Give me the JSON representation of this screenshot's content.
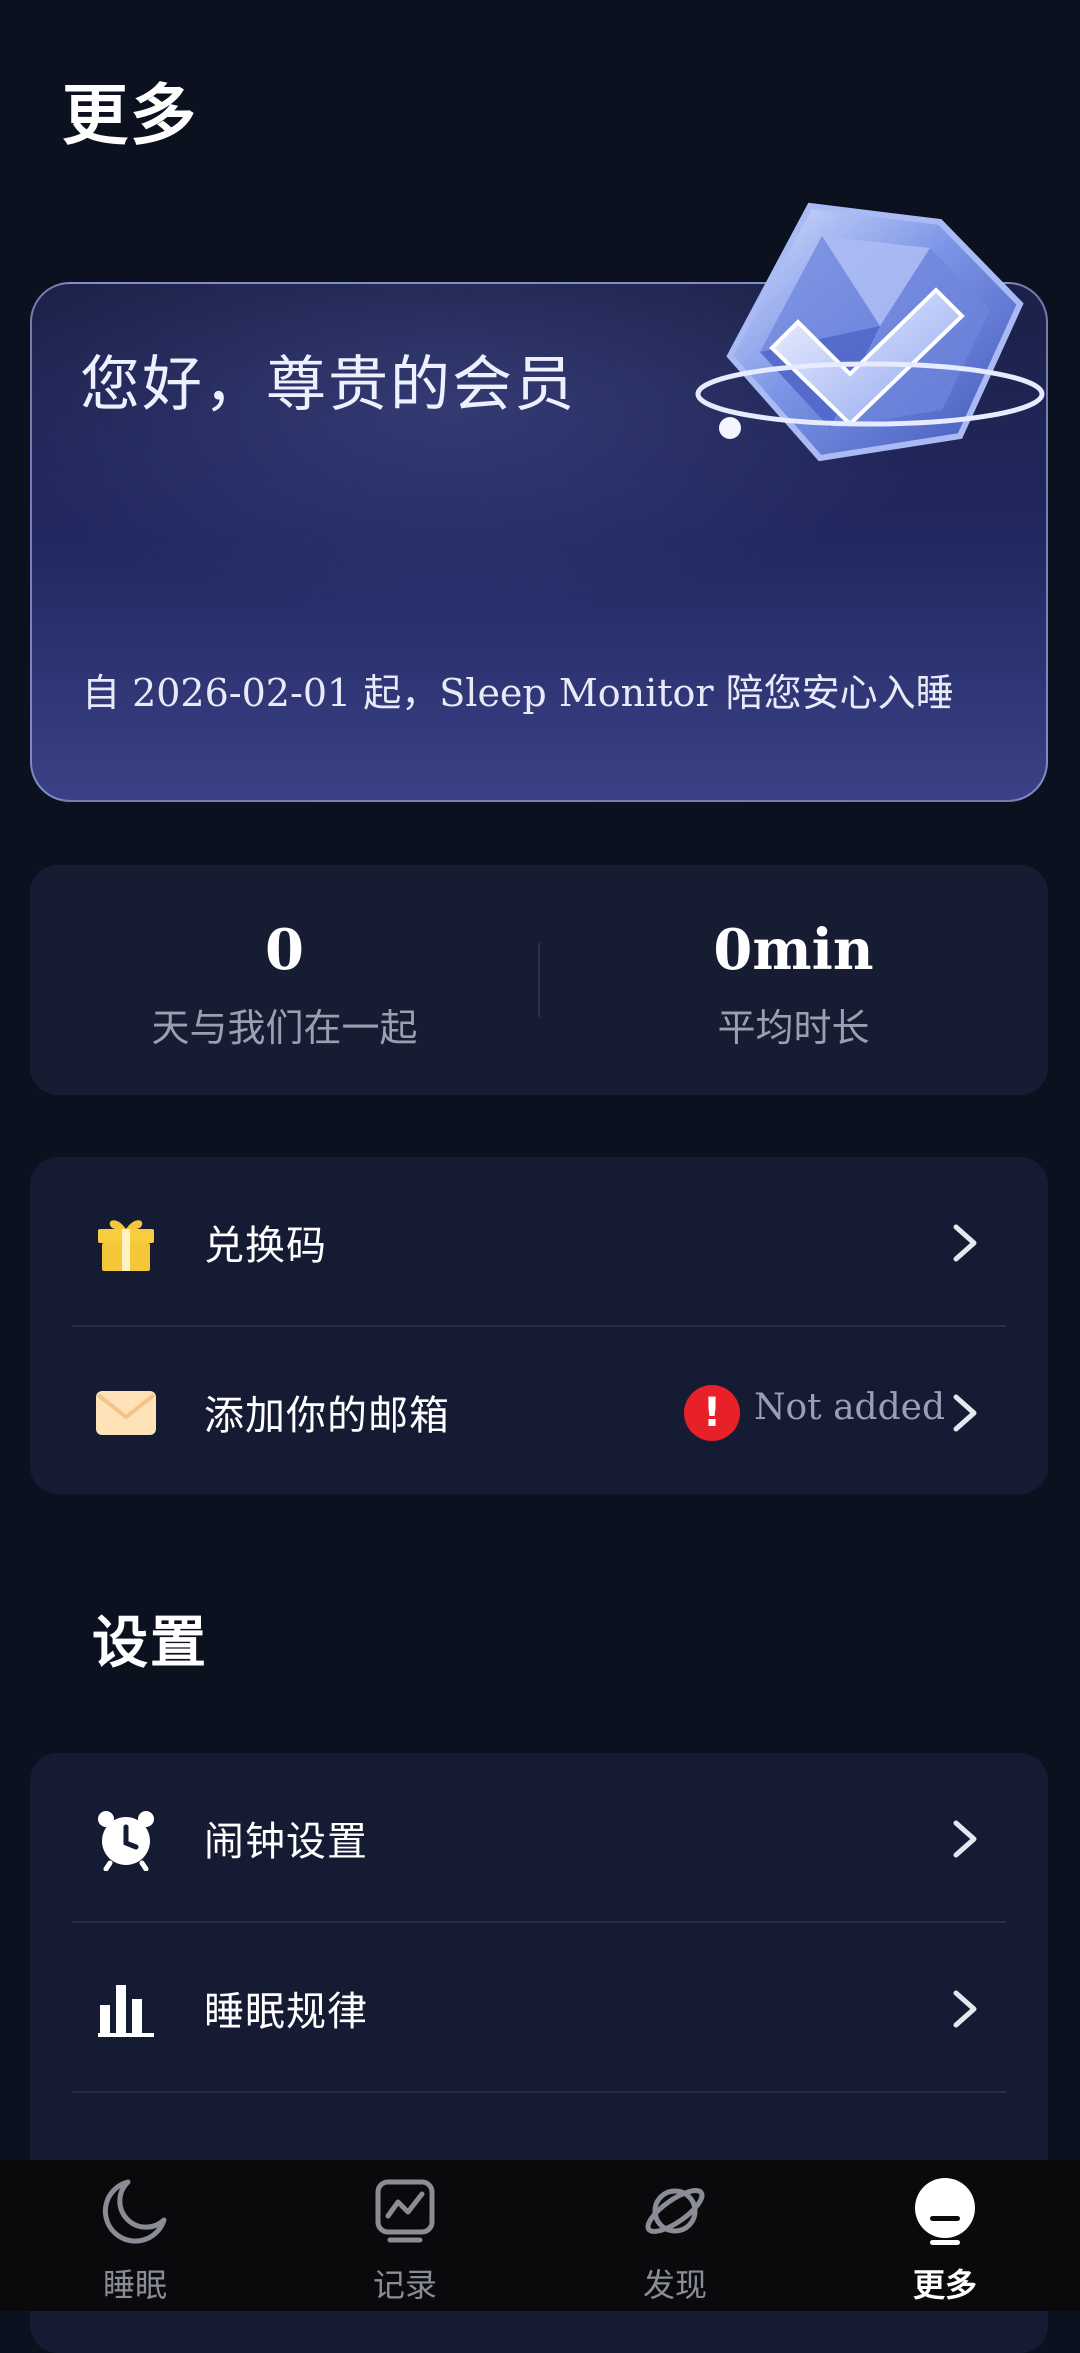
{
  "header": {
    "title": "更多"
  },
  "member_card": {
    "greeting": "您好，尊贵的会员",
    "since_text": "自 2026-02-01 起，Sleep Monitor 陪您安心入睡",
    "badge_icon": "diamond-check-icon"
  },
  "stats": {
    "days_value": "0",
    "days_label": "天与我们在一起",
    "avg_value": "0min",
    "avg_label": "平均时长"
  },
  "account": {
    "items": [
      {
        "label": "兑换码",
        "icon": "gift-icon"
      },
      {
        "label": "添加你的邮箱",
        "icon": "mail-icon",
        "status": "Not added",
        "status_icon": "alert-icon"
      }
    ]
  },
  "settings": {
    "title": "设置",
    "items": [
      {
        "label": "闹钟设置",
        "icon": "alarm-clock-icon"
      },
      {
        "label": "睡眠规律",
        "icon": "bar-chart-icon"
      }
    ]
  },
  "nav": {
    "items": [
      {
        "label": "睡眠",
        "icon": "moon-icon"
      },
      {
        "label": "记录",
        "icon": "report-icon"
      },
      {
        "label": "发现",
        "icon": "planet-icon"
      },
      {
        "label": "更多",
        "icon": "more-icon",
        "active": true
      }
    ]
  },
  "colors": {
    "background": "#0c1120",
    "card": "#151b32",
    "warning": "#e8202a",
    "gift": "#f5c53a",
    "mail": "#ffe2b8"
  }
}
